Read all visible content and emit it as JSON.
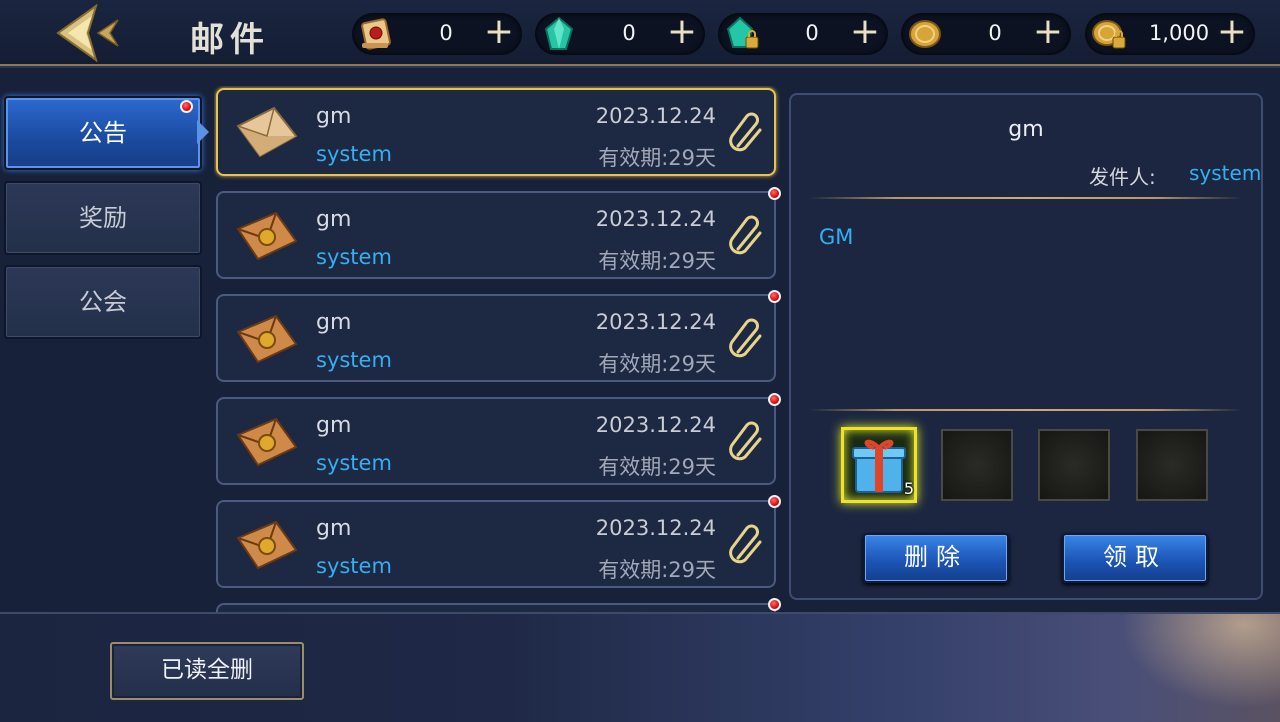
{
  "header": {
    "title": "邮件",
    "back_icon": "chevron-left-icon",
    "currencies": [
      {
        "name": "scroll",
        "icon": "scroll-icon",
        "value": "0"
      },
      {
        "name": "gem",
        "icon": "gem-icon",
        "value": "0"
      },
      {
        "name": "locked-gem",
        "icon": "locked-gem-icon",
        "value": "0"
      },
      {
        "name": "coin",
        "icon": "coin-icon",
        "value": "0"
      },
      {
        "name": "locked-coin",
        "icon": "locked-coin-icon",
        "value": "1,000"
      }
    ],
    "plus_label": "+"
  },
  "tabs": [
    {
      "label": "公告",
      "active": true,
      "has_dot": true
    },
    {
      "label": "奖励",
      "active": false,
      "has_dot": false
    },
    {
      "label": "公会",
      "active": false,
      "has_dot": false
    }
  ],
  "mails": [
    {
      "title": "gm",
      "sender": "system",
      "date": "2023.12.24",
      "expire": "有效期:29天",
      "opened": true,
      "unread": false
    },
    {
      "title": "gm",
      "sender": "system",
      "date": "2023.12.24",
      "expire": "有效期:29天",
      "opened": false,
      "unread": true
    },
    {
      "title": "gm",
      "sender": "system",
      "date": "2023.12.24",
      "expire": "有效期:29天",
      "opened": false,
      "unread": true
    },
    {
      "title": "gm",
      "sender": "system",
      "date": "2023.12.24",
      "expire": "有效期:29天",
      "opened": false,
      "unread": true
    },
    {
      "title": "gm",
      "sender": "system",
      "date": "2023.12.24",
      "expire": "有效期:29天",
      "opened": false,
      "unread": true
    }
  ],
  "detail": {
    "title": "gm",
    "from_label": "发件人:",
    "from": "system",
    "body": "GM",
    "reward": {
      "icon": "gift-box-icon",
      "count": "5"
    },
    "delete_label": "删除",
    "claim_label": "领取"
  },
  "footer": {
    "read_delete_label": "已读全删"
  },
  "colors": {
    "accent_blue": "#35aef2",
    "gold_border": "#e8c250",
    "red_dot": "#d40000"
  }
}
